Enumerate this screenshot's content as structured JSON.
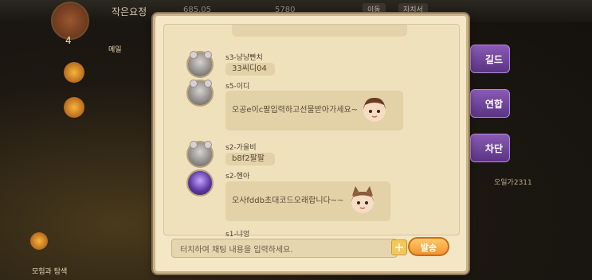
{
  "topbar": {
    "title": "작은요정",
    "res1": "685.05",
    "res2": "5780",
    "btn1": "이동",
    "btn2": "자치서"
  },
  "left": {
    "level": "4",
    "labels": [
      "메일",
      "모험과 탐색"
    ]
  },
  "right": {
    "tabs": [
      "길드",
      "연합",
      "차단"
    ],
    "note": "오일가2311"
  },
  "chat": {
    "messages": [
      {
        "name": "s3-냥냥빤치",
        "text": "33씨디04"
      },
      {
        "name": "s5-이디",
        "text": "오공e이c팔입력하고선물받아가세요~"
      },
      {
        "name": "s2-가을비",
        "text": "b8f2팔팔"
      },
      {
        "name": "s2-헨아",
        "text": "오사fddb초대코드오래합니다~~"
      },
      {
        "name": "s1-냐엉",
        "text": ""
      }
    ],
    "input_placeholder": "터치하여 채팅 내용을 입력하세요.",
    "plus_label": "+",
    "send_label": "발송"
  },
  "colors": {
    "panel": "#f3e7c6",
    "bubble": "#e3d1a8",
    "send": "#f3932d",
    "guild_tab": "#8a5ab5"
  }
}
